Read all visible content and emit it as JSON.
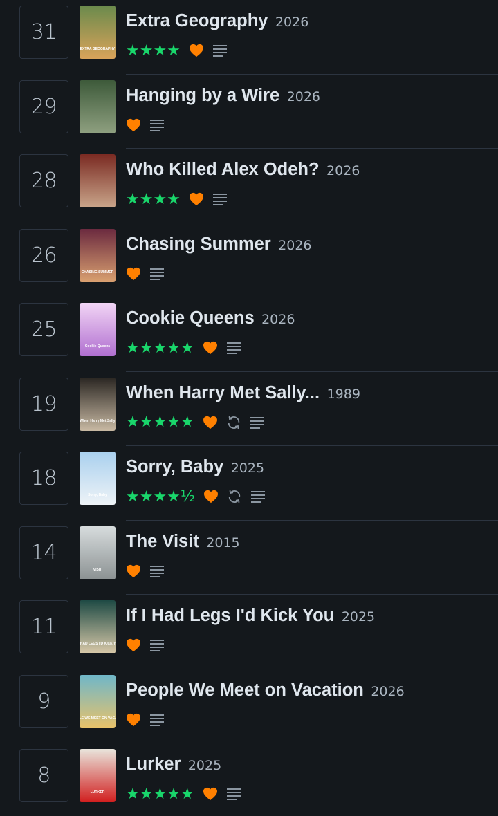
{
  "entries": [
    {
      "day": "31",
      "title": "Extra Geography",
      "year": "2026",
      "stars": "★★★★",
      "liked": true,
      "rewatch": false,
      "review": true,
      "poster_text": "EXTRA GEOGRAPHY",
      "poster_colors": [
        "#6a8a4c",
        "#d9a35a"
      ]
    },
    {
      "day": "29",
      "title": "Hanging by a Wire",
      "year": "2026",
      "stars": "",
      "liked": true,
      "rewatch": false,
      "review": true,
      "poster_text": "",
      "poster_colors": [
        "#3d5a3a",
        "#8fa080"
      ]
    },
    {
      "day": "28",
      "title": "Who Killed Alex Odeh?",
      "year": "2026",
      "stars": "★★★★",
      "liked": true,
      "rewatch": false,
      "review": true,
      "poster_text": "",
      "poster_colors": [
        "#7a2a22",
        "#c9a58a"
      ]
    },
    {
      "day": "26",
      "title": "Chasing Summer",
      "year": "2026",
      "stars": "",
      "liked": true,
      "rewatch": false,
      "review": true,
      "poster_text": "CHASING SUMMER",
      "poster_colors": [
        "#6b2a3f",
        "#d9a070"
      ]
    },
    {
      "day": "25",
      "title": "Cookie Queens",
      "year": "2026",
      "stars": "★★★★★",
      "liked": true,
      "rewatch": false,
      "review": true,
      "poster_text": "Cookie Queens",
      "poster_colors": [
        "#f2d5f5",
        "#b06fd0"
      ]
    },
    {
      "day": "19",
      "title": "When Harry Met Sally...",
      "year": "1989",
      "stars": "★★★★★",
      "liked": true,
      "rewatch": true,
      "review": true,
      "poster_text": "When Harry Met Sally",
      "poster_colors": [
        "#2a2622",
        "#c8b9a3"
      ]
    },
    {
      "day": "18",
      "title": "Sorry, Baby",
      "year": "2025",
      "stars": "★★★★½",
      "liked": true,
      "rewatch": true,
      "review": true,
      "poster_text": "Sorry, Baby",
      "poster_colors": [
        "#a9d0ee",
        "#eef3f7"
      ]
    },
    {
      "day": "14",
      "title": "The Visit",
      "year": "2015",
      "stars": "",
      "liked": true,
      "rewatch": false,
      "review": true,
      "poster_text": "VISIT",
      "poster_colors": [
        "#d7dcdd",
        "#8c9293"
      ]
    },
    {
      "day": "11",
      "title": "If I Had Legs I'd Kick You",
      "year": "2025",
      "stars": "",
      "liked": true,
      "rewatch": false,
      "review": true,
      "poster_text": "IF I HAD LEGS I'D KICK YOU",
      "poster_colors": [
        "#1e4a44",
        "#d8c8a8"
      ]
    },
    {
      "day": "9",
      "title": "People We Meet on Vacation",
      "year": "2026",
      "stars": "",
      "liked": true,
      "rewatch": false,
      "review": true,
      "poster_text": "PEOPLE WE MEET ON VACATION",
      "poster_colors": [
        "#6fb7c9",
        "#e8c26a"
      ]
    },
    {
      "day": "8",
      "title": "Lurker",
      "year": "2025",
      "stars": "★★★★★",
      "liked": true,
      "rewatch": false,
      "review": true,
      "poster_text": "LURKER",
      "poster_colors": [
        "#e9e5dc",
        "#d11f1f"
      ]
    }
  ],
  "colors": {
    "background": "#14181c",
    "star_green": "#19d66b",
    "heart_orange": "#ff8000",
    "icon_gray": "#8b96a1",
    "divider": "#2c3440"
  }
}
